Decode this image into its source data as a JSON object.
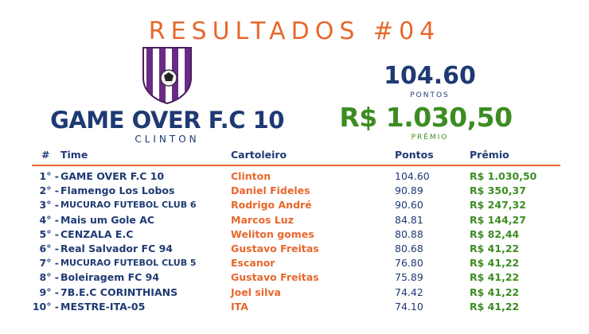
{
  "header": {
    "title": "RESULTADOS #04"
  },
  "winner": {
    "team": "GAME OVER F.C 10",
    "owner": "CLINTON",
    "points": "104.60",
    "points_label": "PONTOS",
    "prize": "R$ 1.030,50",
    "prize_label": "PRÊMIO",
    "shield_colors": {
      "purple": "#6b2a86",
      "white": "#ffffff"
    }
  },
  "table": {
    "headers": {
      "rank": "#",
      "team": "Time",
      "owner": "Cartoleiro",
      "points": "Pontos",
      "prize": "Prêmio"
    },
    "rows": [
      {
        "pos": "1° -",
        "team": "GAME OVER F.C 10",
        "owner": "Clinton",
        "points": "104.60",
        "prize": "R$ 1.030,50"
      },
      {
        "pos": "2° -",
        "team": "Flamengo Los Lobos",
        "owner": "Daniel Fideles",
        "points": "90.89",
        "prize": "R$ 350,37"
      },
      {
        "pos": "3° -",
        "team": "MUCURAO FUTEBOL CLUB 6",
        "owner": "Rodrigo André",
        "points": "90.60",
        "prize": "R$ 247,32"
      },
      {
        "pos": "4° -",
        "team": "Mais um Gole AC",
        "owner": "Marcos Luz",
        "points": "84.81",
        "prize": "R$ 144,27"
      },
      {
        "pos": "5° -",
        "team": "CENZALA E.C",
        "owner": "Weliton gomes",
        "points": "80.88",
        "prize": "R$ 82,44"
      },
      {
        "pos": "6° -",
        "team": "Real Salvador FC 94",
        "owner": "Gustavo Freitas",
        "points": "80.68",
        "prize": "R$ 41,22"
      },
      {
        "pos": "7° -",
        "team": "MUCURAO FUTEBOL CLUB 5",
        "owner": "Escanor",
        "points": "76.80",
        "prize": "R$ 41,22"
      },
      {
        "pos": "8° -",
        "team": "Boleiragem FC 94",
        "owner": "Gustavo Freitas",
        "points": "75.89",
        "prize": "R$ 41,22"
      },
      {
        "pos": "9° -",
        "team": "7B.E.C CORINTHIANS",
        "owner": "Joel silva",
        "points": "74.42",
        "prize": "R$ 41,22"
      },
      {
        "pos": "10° -",
        "team": "MESTRE-ITA-05",
        "owner": "ITA",
        "points": "74.10",
        "prize": "R$ 41,22"
      }
    ]
  },
  "colors": {
    "navy": "#1f3a73",
    "orange": "#e8672c",
    "green": "#3c8c22"
  }
}
